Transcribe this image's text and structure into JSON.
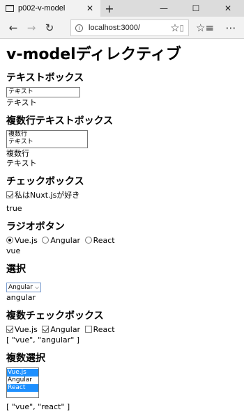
{
  "browser": {
    "tab_title": "p002-v-model",
    "tab_close": "✕",
    "new_tab": "+",
    "minimize": "—",
    "maximize": "☐",
    "close": "✕",
    "back": "←",
    "forward": "→",
    "reload": "↻",
    "url": "localhost:3000/",
    "reader": "📖",
    "favorite": "☆",
    "favorites_bar": "☆≡",
    "more": "⋯"
  },
  "page": {
    "title": "v-modelディレクティブ",
    "textbox": {
      "heading": "テキストボックス",
      "value": "テキスト",
      "output": "テキスト"
    },
    "textarea": {
      "heading": "複数行テキストボックス",
      "lines": [
        "複数行",
        "テキスト"
      ],
      "output_lines": [
        "複数行",
        "テキスト"
      ]
    },
    "checkbox": {
      "heading": "チェックボックス",
      "label": "私はNuxt.jsが好き",
      "checked": true,
      "output": "true"
    },
    "radio": {
      "heading": "ラジオボタン",
      "options": [
        {
          "label": "Vue.js",
          "checked": true
        },
        {
          "label": "Angular",
          "checked": false
        },
        {
          "label": "React",
          "checked": false
        }
      ],
      "output": "vue"
    },
    "select": {
      "heading": "選択",
      "selected": "Angular",
      "output": "angular"
    },
    "multi_checkbox": {
      "heading": "複数チェックボックス",
      "options": [
        {
          "label": "Vue.js",
          "checked": true
        },
        {
          "label": "Angular",
          "checked": true
        },
        {
          "label": "React",
          "checked": false
        }
      ],
      "output": "[ \"vue\", \"angular\" ]"
    },
    "multi_select": {
      "heading": "複数選択",
      "options": [
        {
          "label": "Vue.js",
          "selected": true
        },
        {
          "label": "Angular",
          "selected": false
        },
        {
          "label": "React",
          "selected": true
        }
      ],
      "output": "[ \"vue\", \"react\" ]"
    }
  }
}
